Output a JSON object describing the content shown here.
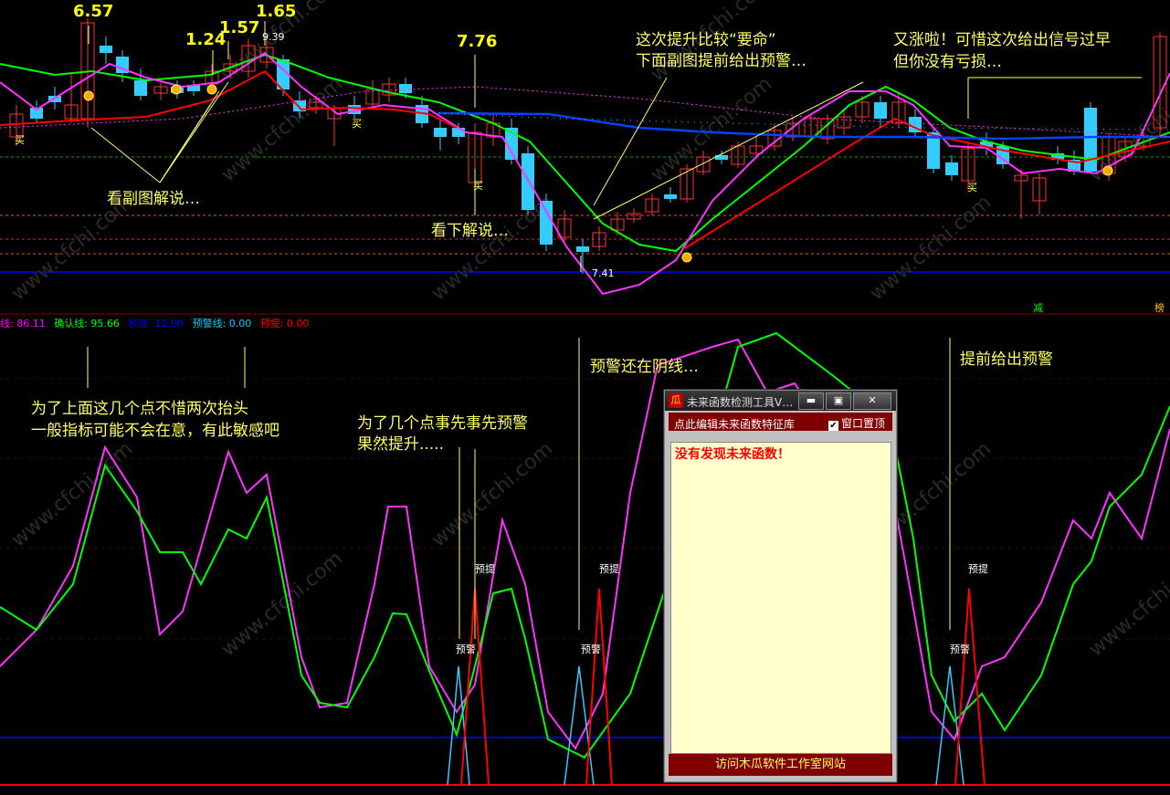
{
  "legend": [
    {
      "label": "线: 86.11",
      "color": "#ff00ff"
    },
    {
      "label": "确认线: 95.66",
      "color": "#00ff00"
    },
    {
      "label": "抄底: 12.00",
      "color": "#0000ff"
    },
    {
      "label": "预警线: 0.00",
      "color": "#00ccff"
    },
    {
      "label": "预提: 0.00",
      "color": "#ff0000"
    }
  ],
  "price_labels": {
    "p1": "6.57",
    "p2": "1.24",
    "p3": "1.57",
    "p4": "1.65",
    "p5": "7.76",
    "high_value": "9.39",
    "low_value": "7.41"
  },
  "annotations": {
    "see_sub": "看副图解说…",
    "see_below": "看下解说…",
    "critical_l1": "这次提升比较“要命”",
    "critical_l2": "下面副图提前给出预警…",
    "rise_l1": "又涨啦！可惜这次给出信号过早",
    "rise_l2": "但你没有亏损…",
    "two_raise_l1": "为了上面这几个点不惜两次抬头",
    "two_raise_l2": "一般指标可能不会在意，有此敏感吧",
    "pre_warn_l1": "为了几个点事先事先预警",
    "pre_warn_l2": "果然提升.....",
    "still_yin": "预警还在阴线…",
    "early_warn": "提前给出预警"
  },
  "markers": {
    "buy": "买",
    "warn": "预警",
    "lift": "预提",
    "jian": "减",
    "bang": "榜"
  },
  "dialog": {
    "title": "未来函数检测工具V…",
    "edit_label": "点此编辑未来函数特征库",
    "pin_label": "窗口置顶",
    "pin_checked": true,
    "result": "没有发现未来函数！",
    "footer": "访问木瓜软件工作室网站",
    "icon": "瓜",
    "buttons": {
      "min": "▬",
      "max": "▣",
      "close": "✕"
    }
  },
  "watermark": "www.cfchi.com",
  "colors": {
    "bg": "#000000",
    "up": "#ff3333",
    "down": "#33ccff",
    "ma_green": "#00ff00",
    "ma_magenta": "#ff33ff",
    "ma_red": "#ff0000",
    "ma_blue": "#0044ff",
    "annot": "#ffff66"
  }
}
